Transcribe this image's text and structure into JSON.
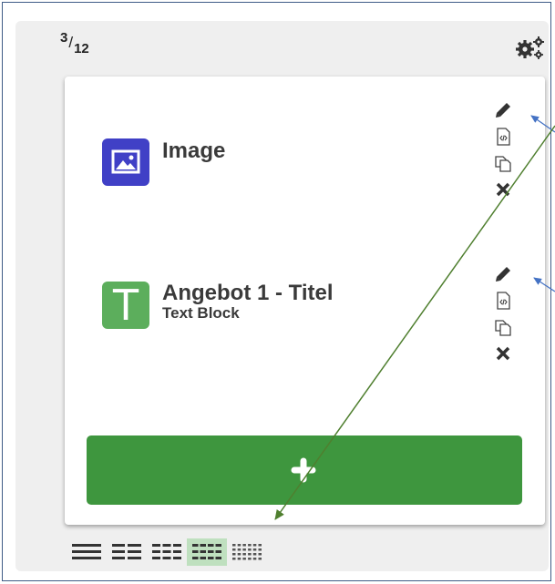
{
  "column_size": {
    "numerator": "3",
    "denominator": "12"
  },
  "blocks": [
    {
      "title": "Image",
      "subtitle": "",
      "icon": "image-icon",
      "color": "#4040c6"
    },
    {
      "title": "Angebot 1 - Titel",
      "subtitle": "Text Block",
      "icon": "text-letter-icon",
      "letter": "T",
      "color": "#5cae5c"
    }
  ],
  "block_actions": [
    "edit-pencil-icon",
    "code-view-icon",
    "duplicate-icon",
    "delete-icon"
  ],
  "add_button": {
    "icon": "plus-icon",
    "color": "#3e963e"
  },
  "layout_options": [
    {
      "icon": "layout-1-col-icon",
      "active": false
    },
    {
      "icon": "layout-2-col-icon",
      "active": false
    },
    {
      "icon": "layout-3-col-icon",
      "active": false
    },
    {
      "icon": "layout-4-col-icon",
      "active": true
    },
    {
      "icon": "layout-6-col-icon",
      "active": false
    }
  ],
  "annotation_colors": {
    "blue_arrow": "#4472c4",
    "green_arrow": "#4f7f2f"
  }
}
